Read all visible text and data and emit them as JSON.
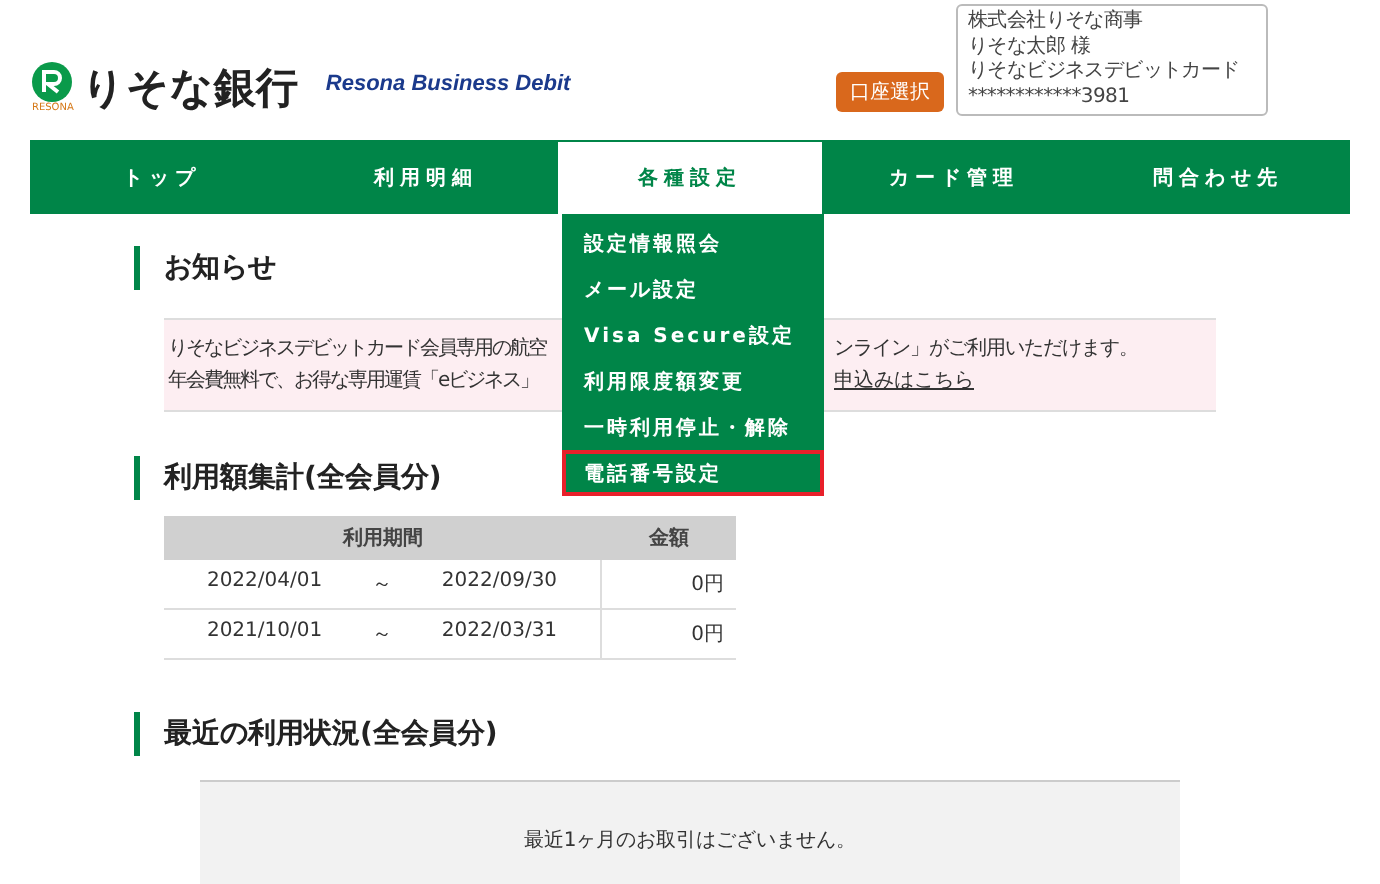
{
  "header": {
    "logo_text": "りそな銀行",
    "logo_sub": "RESONA",
    "product": "Resona Business Debit",
    "account_button": "口座選択",
    "account_info": [
      "株式会社りそな商事",
      "りそな太郎 様",
      "りそなビジネスデビットカード",
      "************3981"
    ]
  },
  "nav": [
    {
      "label": "トップ",
      "selected": false
    },
    {
      "label": "利用明細",
      "selected": false
    },
    {
      "label": "各種設定",
      "selected": true
    },
    {
      "label": "カード管理",
      "selected": false
    },
    {
      "label": "問合わせ先",
      "selected": false
    }
  ],
  "dropdown": [
    {
      "label": "設定情報照会",
      "highlighted": false
    },
    {
      "label": "メール設定",
      "highlighted": false
    },
    {
      "label": "Visa Secure設定",
      "highlighted": false
    },
    {
      "label": "利用限度額変更",
      "highlighted": false
    },
    {
      "label": "一時利用停止・解除",
      "highlighted": false
    },
    {
      "label": "電話番号設定",
      "highlighted": true
    }
  ],
  "notice": {
    "title": "お知らせ",
    "lines": [
      {
        "left": "りそなビジネスデビットカード会員専用の航空",
        "right": "ンライン」がご利用いただけます。"
      },
      {
        "left": "年会費無料で、お得な専用運賃「eビジネス」",
        "link": "申込みはこちら"
      }
    ]
  },
  "summary": {
    "title": "利用額集計(全会員分)",
    "columns": [
      "利用期間",
      "金額"
    ],
    "rows": [
      {
        "from": "2022/04/01",
        "sep": "～",
        "to": "2022/09/30",
        "amount": "0円"
      },
      {
        "from": "2021/10/01",
        "sep": "～",
        "to": "2022/03/31",
        "amount": "0円"
      }
    ]
  },
  "recent": {
    "title": "最近の利用状況(全会員分)",
    "message": "最近1ヶ月のお取引はございません。"
  }
}
